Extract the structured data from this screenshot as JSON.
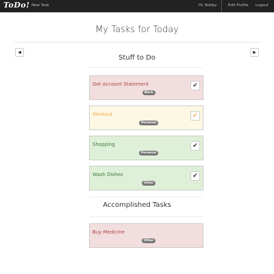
{
  "navbar": {
    "brand": "ToDo!",
    "new_task": "New Task",
    "greeting": "Hi, Bobby",
    "edit_profile": "Edit Profile",
    "logout": "Logout"
  },
  "page": {
    "title": "My Tasks for Today",
    "prev_icon": "chevron-left-icon",
    "next_icon": "chevron-right-icon",
    "prev_label": "◀",
    "next_label": "▶"
  },
  "todo": {
    "title": "Stuff to Do",
    "tasks": [
      {
        "name": "Get Account Statement",
        "tag": "Work",
        "bg": "#f2dede",
        "color": "#a94442",
        "check": "✔",
        "check_color": "#333333"
      },
      {
        "name": "Workout",
        "tag": "Personal",
        "bg": "#fcf8e3",
        "color": "#f0ad4e",
        "check": "✔",
        "check_color": "#f0ad4e"
      },
      {
        "name": "Shopping",
        "tag": "Personal",
        "bg": "#dff0d8",
        "color": "#3c763d",
        "check": "✔",
        "check_color": "#333333"
      },
      {
        "name": "Wash Dishes",
        "tag": "Other",
        "bg": "#dff0d8",
        "color": "#3c763d",
        "check": "✔",
        "check_color": "#333333"
      }
    ]
  },
  "done": {
    "title": "Accomplished Tasks",
    "tasks": [
      {
        "name": "Buy Medicine",
        "tag": "Other",
        "bg": "#f2dede",
        "color": "#a94442"
      }
    ]
  }
}
